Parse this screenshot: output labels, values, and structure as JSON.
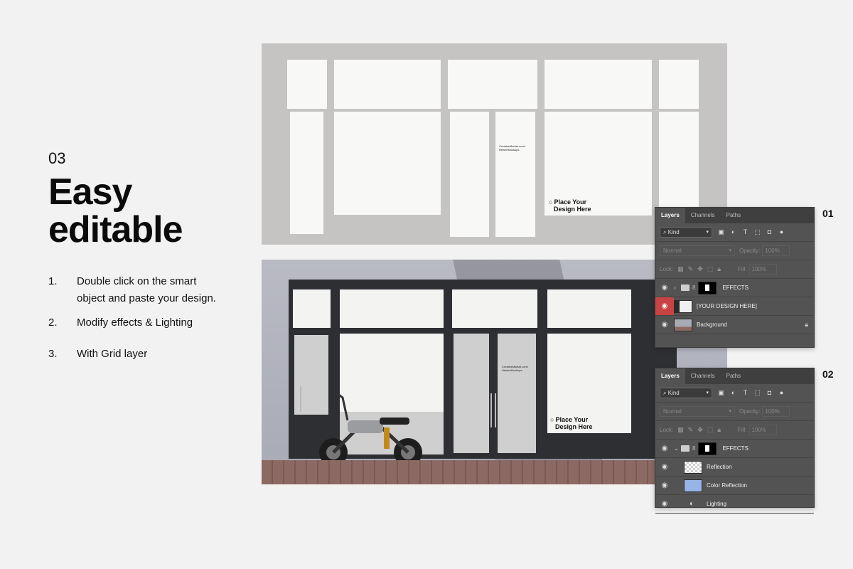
{
  "heading": {
    "step_number": "03",
    "line1": "Easy",
    "line2": "editable"
  },
  "steps": [
    {
      "num": "1.",
      "line1": "Double click on the smart",
      "line2": "object and paste your design."
    },
    {
      "num": "2.",
      "text": "Modify effects & Lighting"
    },
    {
      "num": "3.",
      "text": "With Grid layer"
    }
  ],
  "mockup": {
    "credit_line1": "CreativeMarket.com/",
    "credit_line2": "HeisenMockups",
    "place_line1": "Place Your",
    "place_line2": "Design Here",
    "place_icon": "circle-icon"
  },
  "panel1": {
    "number": "01",
    "tabs": [
      "Layers",
      "Channels",
      "Paths"
    ],
    "kind_label": "Kind",
    "blend_mode": "Normal",
    "opacity_label": "Opacity:",
    "opacity_value": "100%",
    "lock_label": "Lock:",
    "fill_label": "Fill:",
    "fill_value": "100%",
    "layers": [
      "EFFECTS",
      "[YOUR DESIGN HERE]",
      "Background"
    ]
  },
  "panel2": {
    "number": "02",
    "tabs": [
      "Layers",
      "Channels",
      "Paths"
    ],
    "kind_label": "Kind",
    "blend_mode": "Normal",
    "opacity_label": "Opacity:",
    "opacity_value": "100%",
    "lock_label": "Lock:",
    "fill_label": "Fill:",
    "fill_value": "100%",
    "layers": [
      "EFFECTS",
      "Reflection",
      "Color Reflection",
      "Lighting"
    ]
  },
  "colors": {
    "selected_eye": "#c84344",
    "panel_bg": "#535353",
    "color_reflection_swatch": "#98b4e6"
  }
}
